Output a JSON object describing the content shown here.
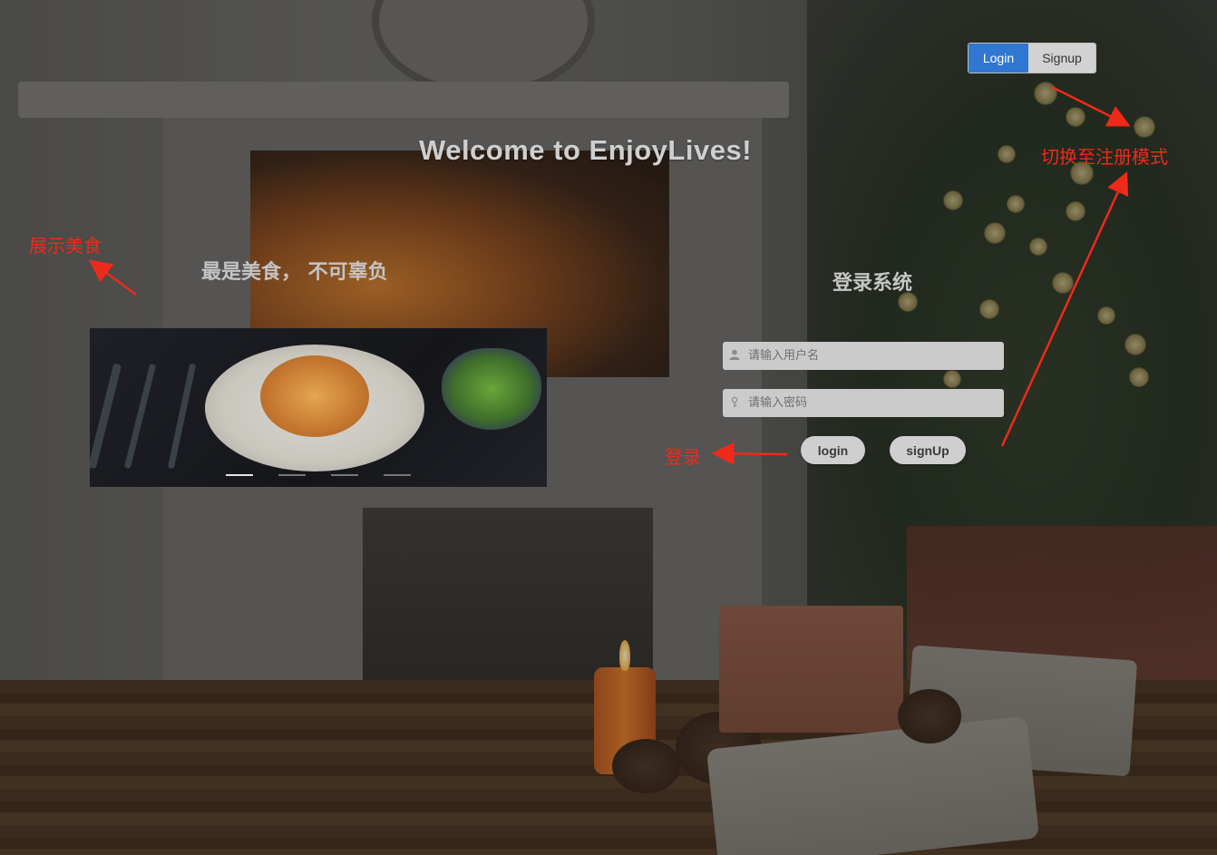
{
  "header": {
    "login_tab": "Login",
    "signup_tab": "Signup",
    "welcome": "Welcome to EnjoyLives!"
  },
  "showcase": {
    "slogan": "最是美食， 不可辜负",
    "carousel_slide_count": 4,
    "carousel_active_index": 0
  },
  "login_panel": {
    "title": "登录系统",
    "username_placeholder": "请输入用户名",
    "password_placeholder": "请输入密码",
    "login_button": "login",
    "signup_button": "signUp"
  },
  "annotations": {
    "switch_mode": "切换至注册模式",
    "show_food": "展示美食",
    "login": "登录"
  },
  "colors": {
    "accent_blue": "#2f77d1",
    "annotation_red": "#ee2a1b"
  },
  "icons": [
    "user-icon",
    "key-icon"
  ]
}
